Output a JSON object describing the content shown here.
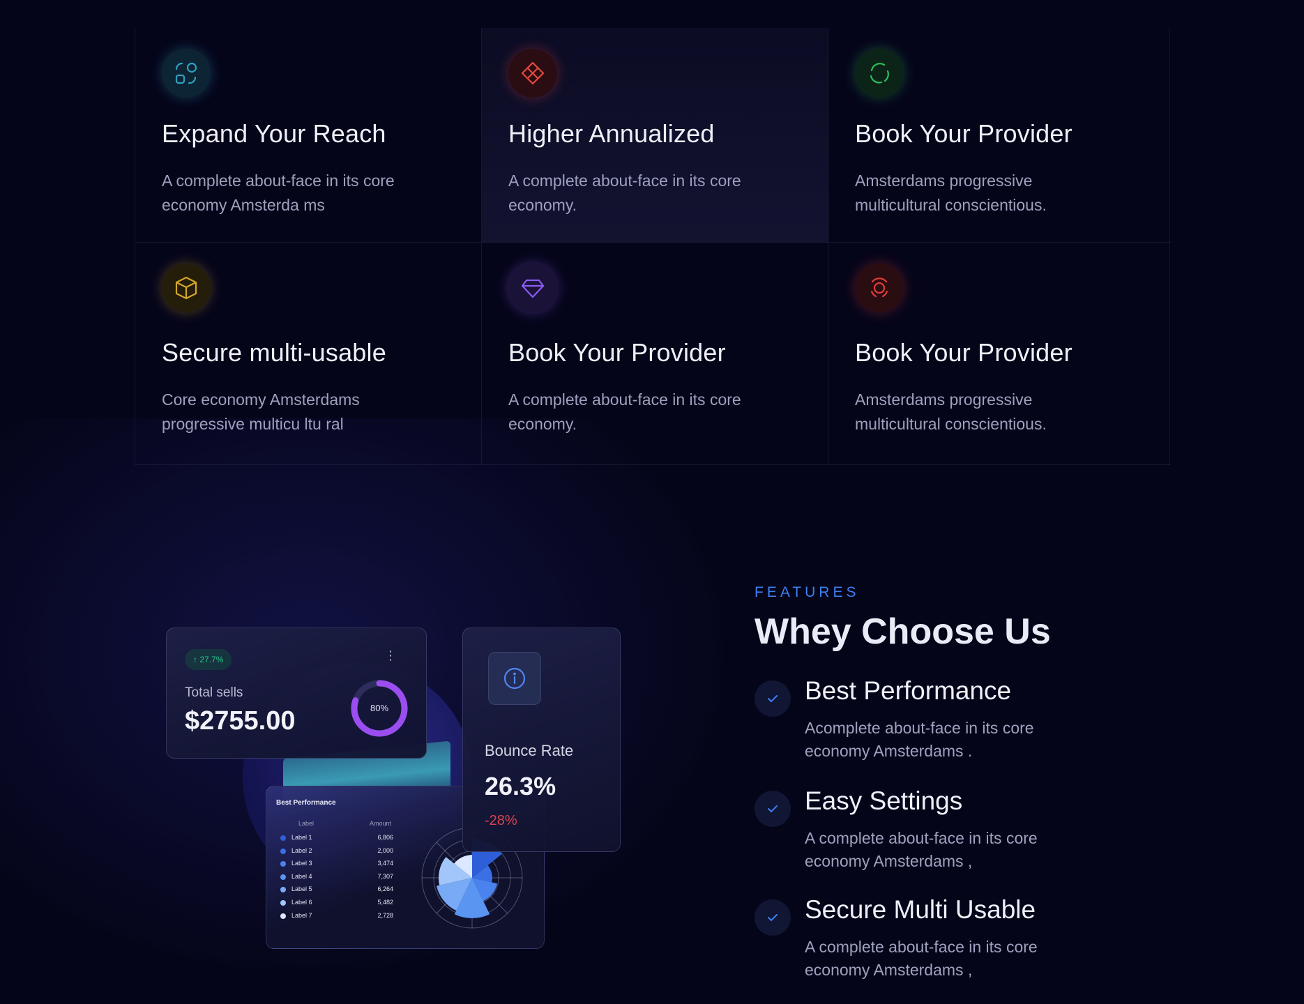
{
  "grid": {
    "cells": [
      {
        "title": "Expand Your Reach",
        "text": "A complete about-face in its core economy Amsterda ms",
        "icon": "shapes-icon",
        "color": "#2f9fc1"
      },
      {
        "title": "Higher Annualized",
        "text": "A complete about-face in its core economy.",
        "icon": "diamond-grid-icon",
        "color": "#e5483e"
      },
      {
        "title": "Book Your Provider",
        "text": "Amsterdams progressive multicultural conscientious.",
        "icon": "circle-arrows-icon",
        "color": "#2dbd5c"
      },
      {
        "title": "Secure multi-usable",
        "text": "Core economy Amsterdams progressive multicu ltu ral",
        "icon": "cube-icon",
        "color": "#d3a52a"
      },
      {
        "title": "Book Your Provider",
        "text": "A complete about-face in its core economy.",
        "icon": "gem-icon",
        "color": "#8a5cf5"
      },
      {
        "title": "Book Your Provider",
        "text": "Amsterdams progressive multicultural conscientious.",
        "icon": "lifebuoy-icon",
        "color": "#e03c3c"
      }
    ]
  },
  "dashboard": {
    "sells": {
      "badge": "↑ 27.7%",
      "label": "Total sells",
      "value": "$2755.00",
      "progress_label": "80%",
      "progress": 0.8
    },
    "bounce": {
      "label": "Bounce Rate",
      "value": "26.3%",
      "change": "-28%"
    },
    "performance": {
      "title": "Best Performance",
      "col_label": "Label",
      "col_amount": "Amount",
      "rows": [
        {
          "label": "Label 1",
          "amount": "6,806",
          "color": "#2e5fd8"
        },
        {
          "label": "Label 2",
          "amount": "2,000",
          "color": "#3a6fe6"
        },
        {
          "label": "Label 3",
          "amount": "3,474",
          "color": "#4a82ee"
        },
        {
          "label": "Label 4",
          "amount": "7,307",
          "color": "#5b95f2"
        },
        {
          "label": "Label 5",
          "amount": "6,264",
          "color": "#78aaf5"
        },
        {
          "label": "Label 6",
          "amount": "5,482",
          "color": "#a3c6fa"
        },
        {
          "label": "Label 7",
          "amount": "2,728",
          "color": "#dbe8ff"
        }
      ]
    }
  },
  "features": {
    "eyebrow": "FEATURES",
    "heading": "Whey Choose Us",
    "items": [
      {
        "title": "Best Performance",
        "text": "Acomplete about-face in its core economy Amsterdams ."
      },
      {
        "title": "Easy Settings",
        "text": "A complete about-face in its core economy Amsterdams ,"
      },
      {
        "title": "Secure Multi Usable",
        "text": "A complete about-face in its core economy Amsterdams ,"
      }
    ]
  },
  "colors": {
    "accent": "#3e7ff0",
    "background": "#05051a",
    "negative": "#d9414f",
    "positive": "#28c48b",
    "donut": "#9b4ef0"
  }
}
